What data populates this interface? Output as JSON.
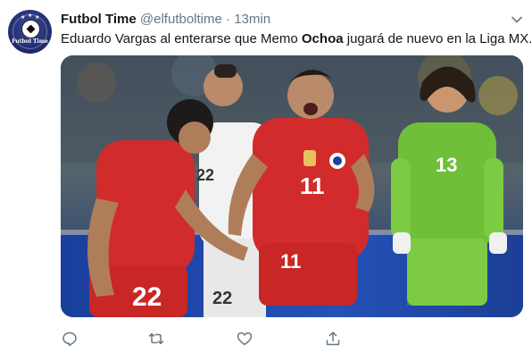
{
  "tweet": {
    "display_name": "Futbol Time",
    "handle": "@elfutboltime",
    "separator": "·",
    "time": "13min",
    "text_before": "Eduardo Vargas al enterarse que Memo ",
    "text_bold": "Ochoa",
    "text_after": " jugará de nuevo en la Liga MX.",
    "avatar_text": "Futbol Time"
  },
  "media": {
    "jersey_numbers": [
      "22",
      "11",
      "13",
      "22",
      "11",
      "22"
    ]
  },
  "actions": [
    "reply-icon",
    "retweet-icon",
    "like-icon",
    "share-icon"
  ],
  "colors": {
    "chile_red": "#d22b2b",
    "mexico_white": "#f2f2f2",
    "keeper_green": "#6fbf3a",
    "icon_gray": "#657786"
  }
}
